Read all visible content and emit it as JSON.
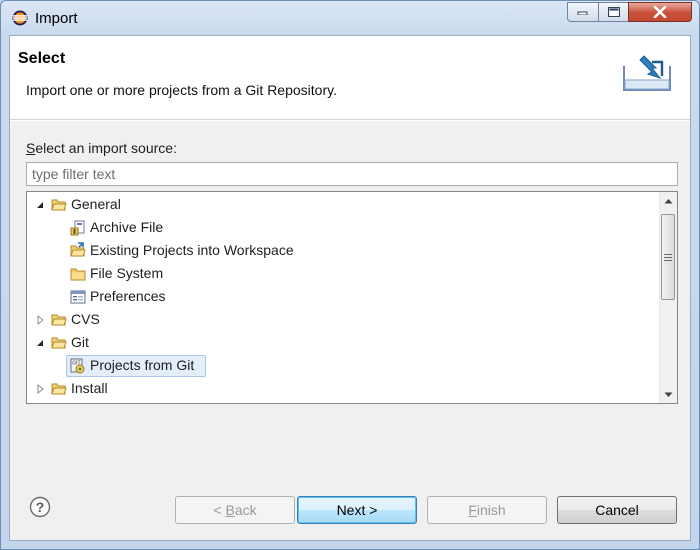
{
  "window": {
    "title": "Import"
  },
  "header": {
    "title": "Select",
    "description": "Import one or more projects from a Git Repository."
  },
  "source": {
    "label_accel": "S",
    "label_rest": "elect an import source:",
    "filter_placeholder": "type filter text",
    "filter_value": ""
  },
  "tree": {
    "items": [
      {
        "label": "General",
        "expanded": true,
        "icon": "folder-open-icon"
      },
      {
        "label": "Archive File",
        "icon": "archive-file-icon"
      },
      {
        "label": "Existing Projects into Workspace",
        "icon": "existing-projects-icon"
      },
      {
        "label": "File System",
        "icon": "folder-icon"
      },
      {
        "label": "Preferences",
        "icon": "preferences-icon"
      },
      {
        "label": "CVS",
        "expanded": false,
        "icon": "folder-open-icon"
      },
      {
        "label": "Git",
        "expanded": true,
        "icon": "folder-open-icon"
      },
      {
        "label": "Projects from Git",
        "selected": true,
        "icon": "git-project-icon"
      },
      {
        "label": "Install",
        "expanded": false,
        "icon": "folder-open-icon"
      }
    ]
  },
  "buttons": {
    "back_prefix": "< ",
    "back_accel": "B",
    "back_rest": "ack",
    "next": "Next >",
    "finish_accel": "F",
    "finish_rest": "inish",
    "cancel": "Cancel"
  },
  "colors": {
    "folder": "#e8c15a",
    "selection_bg": "#e3eefa",
    "selection_border": "#a8c7ea",
    "close_button": "#c8503a"
  }
}
